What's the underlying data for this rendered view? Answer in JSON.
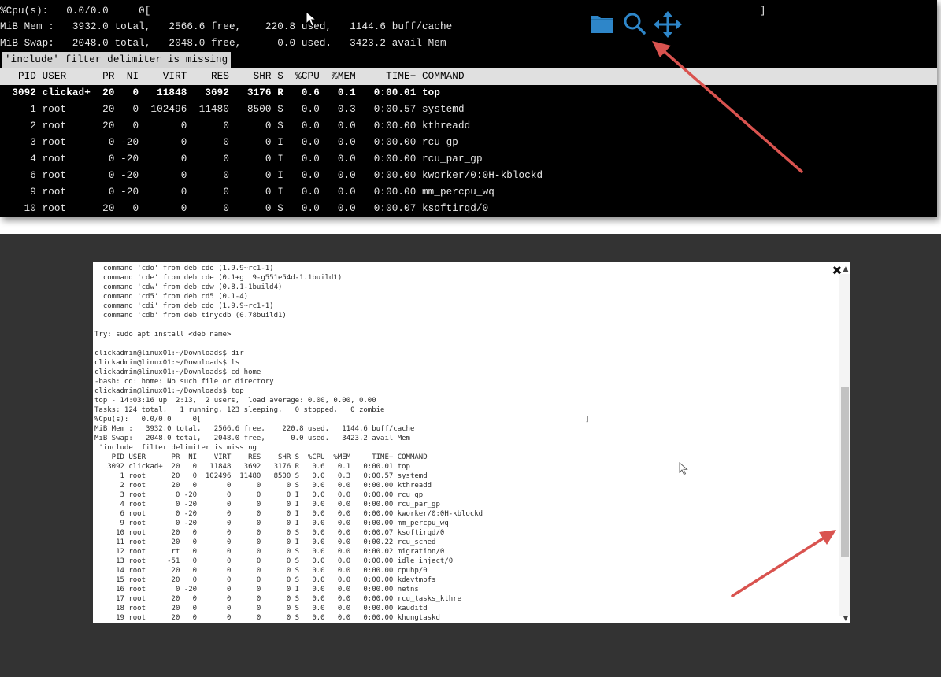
{
  "zoom_view": {
    "lines": [
      "%Cpu(s):   0.0/0.0     0[                                                                                                     ]",
      "MiB Mem :   3932.0 total,   2566.6 free,    220.8 used,   1144.6 buff/cache",
      "MiB Swap:   2048.0 total,   2048.0 free,      0.0 used.   3423.2 avail Mem"
    ],
    "warning": "'include' filter delimiter is missing",
    "header": "   PID USER      PR  NI    VIRT    RES    SHR S  %CPU  %MEM     TIME+ COMMAND",
    "rows": [
      "  3092 clickad+  20   0   11848   3692   3176 R   0.6   0.1   0:00.01 top",
      "     1 root      20   0  102496  11480   8500 S   0.0   0.3   0:00.57 systemd",
      "     2 root      20   0       0      0      0 S   0.0   0.0   0:00.00 kthreadd",
      "     3 root       0 -20       0      0      0 I   0.0   0.0   0:00.00 rcu_gp",
      "     4 root       0 -20       0      0      0 I   0.0   0.0   0:00.00 rcu_par_gp",
      "     6 root       0 -20       0      0      0 I   0.0   0.0   0:00.00 kworker/0:0H-kblockd",
      "     9 root       0 -20       0      0      0 I   0.0   0.0   0:00.00 mm_percpu_wq",
      "    10 root      20   0       0      0      0 S   0.0   0.0   0:00.07 ksoftirqd/0"
    ],
    "icons": [
      "folder-icon",
      "search-icon",
      "move-icon"
    ]
  },
  "terminal": {
    "lines": [
      "  command 'cdo' from deb cdo (1.9.9~rc1-1)",
      "  command 'cde' from deb cde (0.1+git9-g551e54d-1.1build1)",
      "  command 'cdw' from deb cdw (0.8.1-1build4)",
      "  command 'cd5' from deb cd5 (0.1-4)",
      "  command 'cdi' from deb cdo (1.9.9~rc1-1)",
      "  command 'cdb' from deb tinycdb (0.78build1)",
      "",
      "Try: sudo apt install <deb name>",
      "",
      "clickadmin@linux01:~/Downloads$ dir",
      "clickadmin@linux01:~/Downloads$ ls",
      "clickadmin@linux01:~/Downloads$ cd home",
      "-bash: cd: home: No such file or directory",
      "clickadmin@linux01:~/Downloads$ top",
      "top - 14:03:16 up  2:13,  2 users,  load average: 0.00, 0.00, 0.00",
      "Tasks: 124 total,   1 running, 123 sleeping,   0 stopped,   0 zombie",
      "%Cpu(s):   0.0/0.0     0[                                                                                          ]",
      "MiB Mem :   3932.0 total,   2566.6 free,    220.8 used,   1144.6 buff/cache",
      "MiB Swap:   2048.0 total,   2048.0 free,      0.0 used.   3423.2 avail Mem",
      " 'include' filter delimiter is missing",
      "    PID USER      PR  NI    VIRT    RES    SHR S  %CPU  %MEM     TIME+ COMMAND",
      "   3092 clickad+  20   0   11848   3692   3176 R   0.6   0.1   0:00.01 top",
      "      1 root      20   0  102496  11480   8500 S   0.0   0.3   0:00.57 systemd",
      "      2 root      20   0       0      0      0 S   0.0   0.0   0:00.00 kthreadd",
      "      3 root       0 -20       0      0      0 I   0.0   0.0   0:00.00 rcu_gp",
      "      4 root       0 -20       0      0      0 I   0.0   0.0   0:00.00 rcu_par_gp",
      "      6 root       0 -20       0      0      0 I   0.0   0.0   0:00.00 kworker/0:0H-kblockd",
      "      9 root       0 -20       0      0      0 I   0.0   0.0   0:00.00 mm_percpu_wq",
      "     10 root      20   0       0      0      0 S   0.0   0.0   0:00.07 ksoftirqd/0",
      "     11 root      20   0       0      0      0 I   0.0   0.0   0:00.22 rcu_sched",
      "     12 root      rt   0       0      0      0 S   0.0   0.0   0:00.02 migration/0",
      "     13 root     -51   0       0      0      0 S   0.0   0.0   0:00.00 idle_inject/0",
      "     14 root      20   0       0      0      0 S   0.0   0.0   0:00.00 cpuhp/0",
      "     15 root      20   0       0      0      0 S   0.0   0.0   0:00.00 kdevtmpfs",
      "     16 root       0 -20       0      0      0 I   0.0   0.0   0:00.00 netns",
      "     17 root      20   0       0      0      0 S   0.0   0.0   0:00.00 rcu_tasks_kthre",
      "     18 root      20   0       0      0      0 S   0.0   0.0   0:00.00 kauditd",
      "     19 root      20   0       0      0      0 S   0.0   0.0   0:00.00 khungtaskd"
    ],
    "close_label": "✖",
    "scroll_up_label": "▲",
    "scroll_down_label": "▼"
  },
  "colors": {
    "accent_blue": "#2e86c9",
    "arrow_red": "#d9534f",
    "backdrop": "#333333"
  }
}
